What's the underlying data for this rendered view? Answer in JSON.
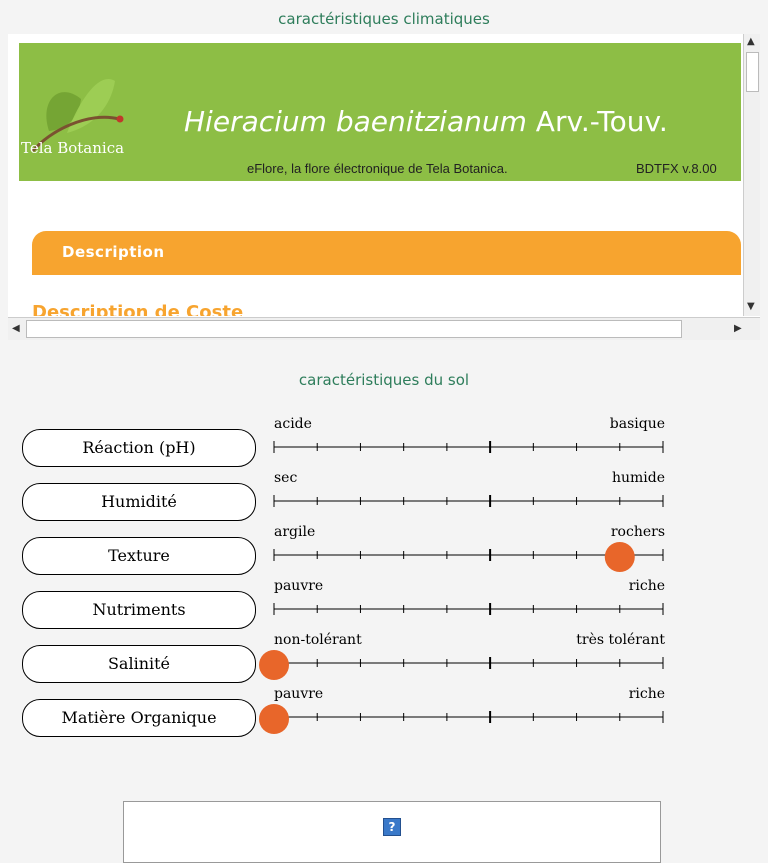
{
  "headers": {
    "climate": "caractéristiques climatiques",
    "soil": "caractéristiques du sol"
  },
  "banner": {
    "logo_text": "Tela Botanica",
    "taxon_name": "Hieracium baenitzianum",
    "taxon_author": "Arv.-Touv.",
    "subtitle": "eFlore, la flore électronique de Tela Botanica.",
    "version": "BDTFX v.8.00"
  },
  "description": {
    "tab_label": "Description",
    "section_title": "Description de Coste"
  },
  "soil_scales": [
    {
      "name": "Réaction (pH)",
      "left": "acide",
      "right": "basique",
      "value": null
    },
    {
      "name": "Humidité",
      "left": "sec",
      "right": "humide",
      "value": null
    },
    {
      "name": "Texture",
      "left": "argile",
      "right": "rochers",
      "value": 8
    },
    {
      "name": "Nutriments",
      "left": "pauvre",
      "right": "riche",
      "value": null
    },
    {
      "name": "Salinité",
      "left": "non-tolérant",
      "right": "très tolérant",
      "value": 0
    },
    {
      "name": "Matière Organique",
      "left": "pauvre",
      "right": "riche",
      "value": 0
    }
  ],
  "scale_max": 9,
  "colors": {
    "banner": "#8dbe45",
    "accent": "#f7a42f",
    "marker": "#e8662a",
    "header_text": "#2e7d5b"
  },
  "help_icon": "question-mark-icon",
  "help_symbol": "?"
}
